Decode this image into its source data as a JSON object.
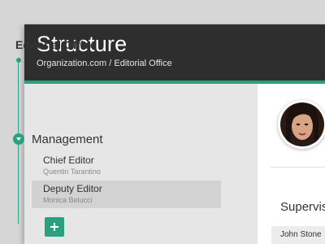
{
  "header": {
    "title": "Structure",
    "breadcrumb": "Organization.com / Editorial Office"
  },
  "sidebar": {
    "section_title": "Editorial Office",
    "group": {
      "label": "Management",
      "items": [
        {
          "title": "Chief Editor",
          "name": "Quentin Tarantino",
          "selected": false
        },
        {
          "title": "Deputy Editor",
          "name": "Monica Belucci",
          "selected": true
        }
      ]
    },
    "add_icon": "plus-icon"
  },
  "profile": {
    "avatar_icon": "avatar",
    "supervisor_label": "Supervis",
    "supervisor_rows": [
      "John Stone"
    ]
  },
  "colors": {
    "accent": "#2aa07f",
    "header_bg": "#2e2e2e"
  }
}
